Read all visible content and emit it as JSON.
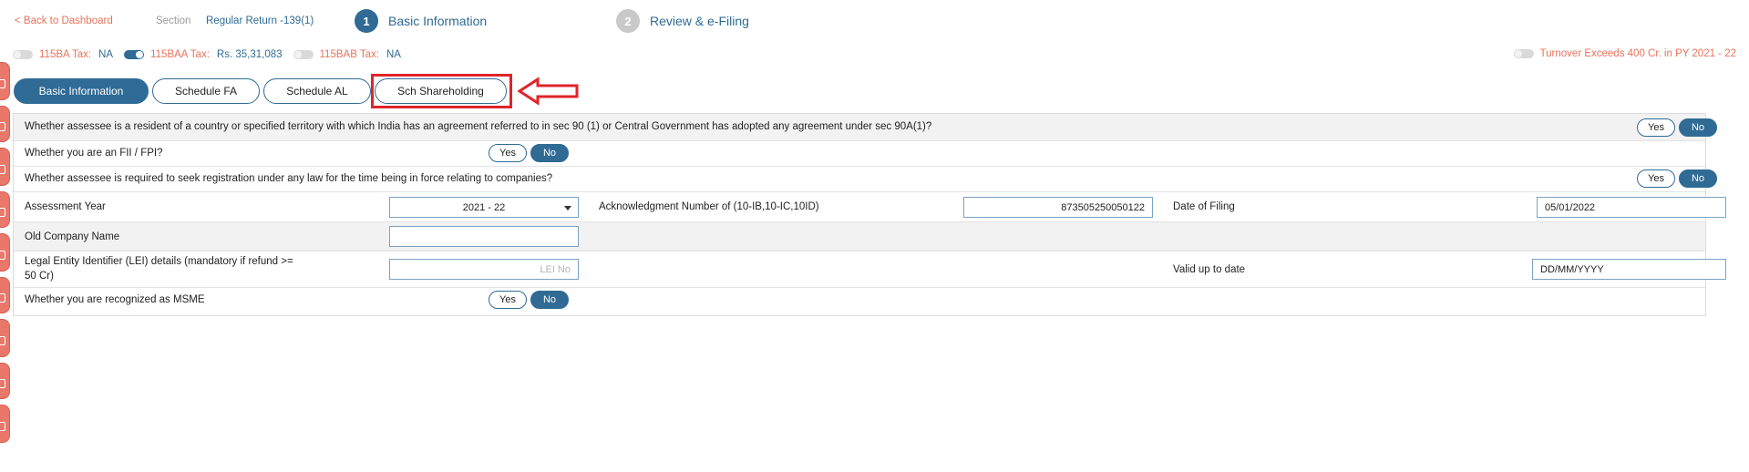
{
  "topbar": {
    "back_label": "< Back to Dashboard",
    "section_label": "Section",
    "section_value": "Regular Return -139(1)",
    "steps": [
      {
        "number": "1",
        "label": "Basic Information"
      },
      {
        "number": "2",
        "label": "Review & e-Filing"
      }
    ]
  },
  "tax": {
    "items": [
      {
        "label": "115BA Tax:",
        "value": "NA",
        "on": false
      },
      {
        "label": "115BAA Tax:",
        "value": "Rs. 35,31,083",
        "on": true
      },
      {
        "label": "115BAB Tax:",
        "value": "NA",
        "on": false
      }
    ],
    "turnover_label": "Turnover Exceeds 400 Cr. in PY 2021 - 22"
  },
  "subtabs": [
    "Basic Information",
    "Schedule FA",
    "Schedule AL",
    "Sch Shareholding"
  ],
  "form": {
    "q_dtaa": "Whether assessee is a resident of a country or specified territory with which India has an agreement referred to in sec 90 (1) or Central Government has adopted any agreement under sec 90A(1)?",
    "q_fii": "Whether you are an FII / FPI?",
    "q_registration": "Whether assessee is required to seek registration under any law for the time being in force relating to companies?",
    "yes": "Yes",
    "no": "No",
    "assessment_year_label": "Assessment Year",
    "assessment_year_value": "2021 - 22",
    "ack_label": "Acknowledgment Number of (10-IB,10-IC,10ID)",
    "ack_value": "873505250050122",
    "filing_date_label": "Date of Filing",
    "filing_date_value": "05/01/2022",
    "old_company_label": "Old Company Name",
    "old_company_value": "",
    "lei_label_line1": "Legal Entity Identifier (LEI) details (mandatory if refund >=",
    "lei_label_line2": "50 Cr)",
    "lei_placeholder": "LEI No",
    "valid_up_to_label": "Valid up to date",
    "valid_up_to_value": "DD/MM/YYYY",
    "q_msme": "Whether you are recognized as MSME"
  },
  "colors": {
    "primary": "#2f6b95",
    "accent": "#e8735a",
    "highlight": "#e0242a"
  }
}
